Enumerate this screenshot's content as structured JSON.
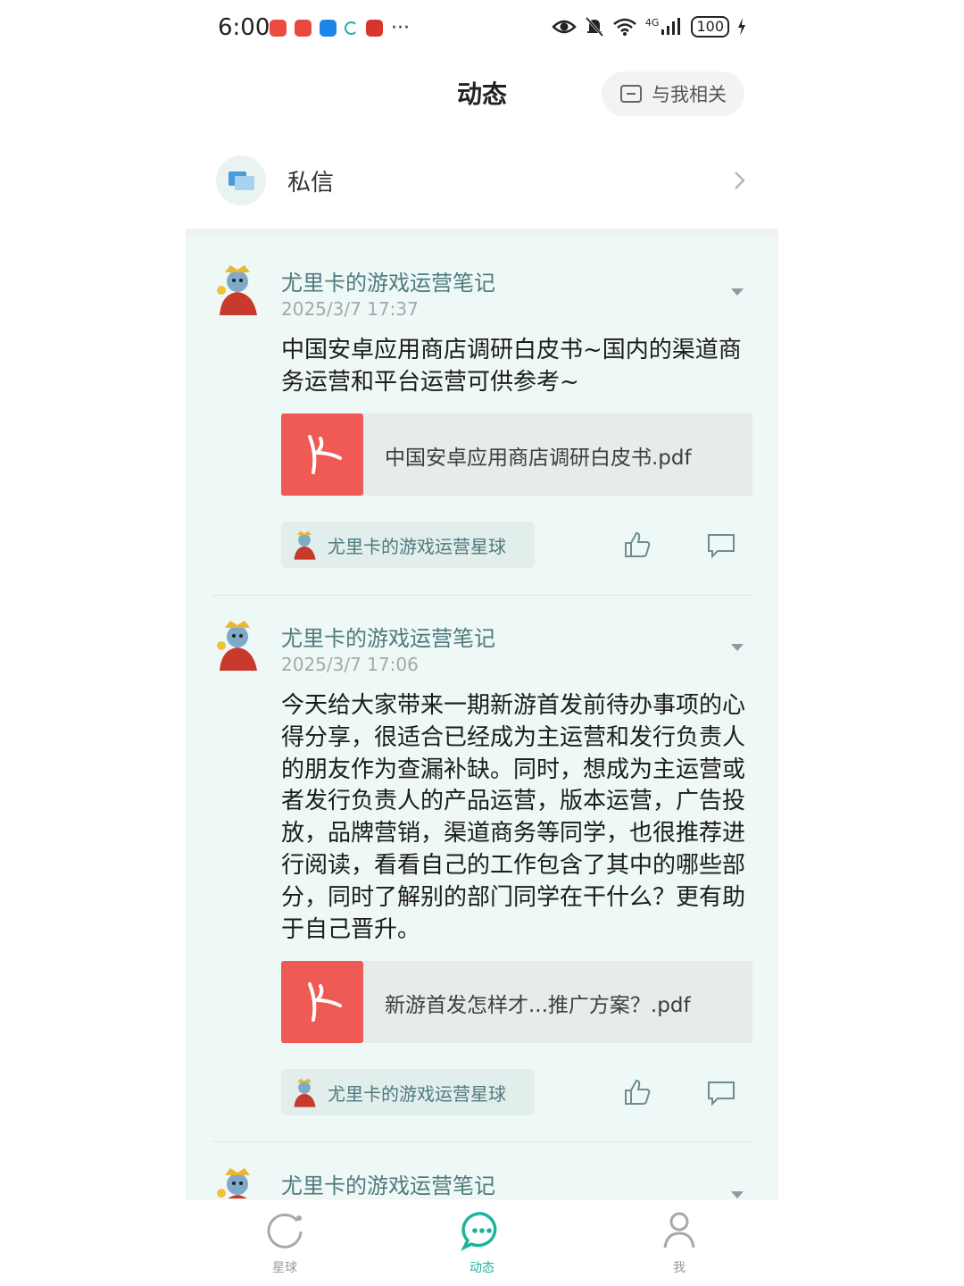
{
  "status_bar": {
    "time": "6:00",
    "notification_icons": [
      "app-notification-icon",
      "app-notification-icon",
      "app-notification-icon",
      "sync-icon",
      "app-notification-icon"
    ],
    "more": "···",
    "network": "4G",
    "battery": "100"
  },
  "header": {
    "title": "动态",
    "related_label": "与我相关"
  },
  "private_messages": {
    "label": "私信"
  },
  "posts": [
    {
      "author": "尤里卡的游戏运营笔记",
      "time": "2025/3/7 17:37",
      "text": "中国安卓应用商店调研白皮书~国内的渠道商务运营和平台运营可供参考~",
      "file_name": "中国安卓应用商店调研白皮书.pdf",
      "tag": "尤里卡的游戏运营星球"
    },
    {
      "author": "尤里卡的游戏运营笔记",
      "time": "2025/3/7 17:06",
      "text": "今天给大家带来一期新游首发前待办事项的心得分享，很适合已经成为主运营和发行负责人的朋友作为查漏补缺。同时，想成为主运营或者发行负责人的产品运营，版本运营，广告投放，品牌营销，渠道商务等同学，也很推荐进行阅读，看看自己的工作包含了其中的哪些部分，同时了解别的部门同学在干什么？更有助于自己晋升。",
      "file_name": "新游首发怎样才...推广方案？.pdf",
      "tag": "尤里卡的游戏运营星球"
    },
    {
      "author": "尤里卡的游戏运营笔记"
    }
  ],
  "bottom_nav": [
    {
      "label": "星球",
      "icon": "planet-icon",
      "active": false
    },
    {
      "label": "动态",
      "icon": "chat-bubble-icon",
      "active": true
    },
    {
      "label": "我",
      "icon": "person-icon",
      "active": false
    }
  ],
  "colors": {
    "accent": "#1fb39c",
    "pdf_red": "#f05a55",
    "author": "#4f7a7e",
    "feed_bg": "#eef8f6"
  }
}
